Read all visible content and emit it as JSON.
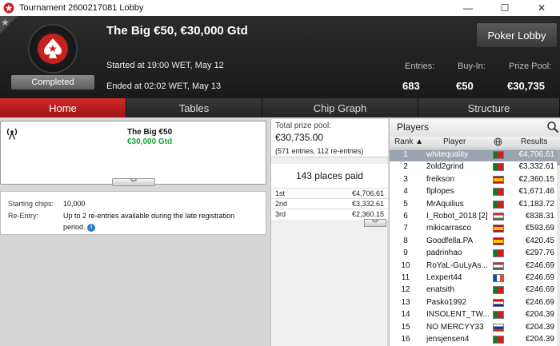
{
  "window": {
    "title": "Tournament 2600217081 Lobby"
  },
  "header": {
    "tournament_name": "The Big €50, €30,000 Gtd",
    "status": "Completed",
    "started": "Started at 19:00 WET, May 12",
    "ended": "Ended at 02:02 WET, May 13",
    "entries_label": "Entries:",
    "entries_value": "683",
    "buyin_label": "Buy-In:",
    "buyin_value": "€50",
    "prizepool_label": "Prize Pool:",
    "prizepool_value": "€30,735",
    "poker_lobby_label": "Poker Lobby"
  },
  "tabs": [
    "Home",
    "Tables",
    "Chip Graph",
    "Structure"
  ],
  "info": {
    "game_name": "The Big €50",
    "game_guarantee": "€30,000 Gtd",
    "starting_chips_label": "Starting chips:",
    "starting_chips_value": "10,000",
    "reentry_label": "Re-Entry:",
    "reentry_value": "Up to 2 re-entries available during the late registration period."
  },
  "prize": {
    "total_label": "Total prize pool:",
    "total_value": "€30,735.00",
    "entries_text": "(571 entries, 112 re-entries)",
    "places_paid": "143 places paid",
    "payouts": [
      {
        "place": "1st",
        "amount": "€4,706.61"
      },
      {
        "place": "2nd",
        "amount": "€3,332.61"
      },
      {
        "place": "3rd",
        "amount": "€2,360.15"
      }
    ]
  },
  "players": {
    "title": "Players",
    "columns": {
      "rank": "Rank",
      "player": "Player",
      "results": "Results"
    },
    "rows": [
      {
        "rank": "1",
        "name": "whitequality",
        "flag": "portugal",
        "result": "€4,706.61"
      },
      {
        "rank": "2",
        "name": "2old2grind",
        "flag": "portugal",
        "result": "€3,332.61"
      },
      {
        "rank": "3",
        "name": "freikson",
        "flag": "spain",
        "result": "€2,360.15"
      },
      {
        "rank": "4",
        "name": "flplopes",
        "flag": "portugal",
        "result": "€1,671.46"
      },
      {
        "rank": "5",
        "name": "MrAquilius",
        "flag": "portugal",
        "result": "€1,183.72"
      },
      {
        "rank": "6",
        "name": "I_Robot_2018 [2]",
        "flag": "hungary",
        "result": "€838.31"
      },
      {
        "rank": "7",
        "name": "mikicarrasco",
        "flag": "spain",
        "result": "€593.69"
      },
      {
        "rank": "8",
        "name": "Goodfella.PA",
        "flag": "spain",
        "result": "€420.45"
      },
      {
        "rank": "9",
        "name": "padrinhao",
        "flag": "portugal",
        "result": "€297.76"
      },
      {
        "rank": "10",
        "name": "RoYaL-GuLyAs...",
        "flag": "hungary",
        "result": "€246.69"
      },
      {
        "rank": "11",
        "name": "Lexpert44",
        "flag": "france",
        "result": "€246.69"
      },
      {
        "rank": "12",
        "name": "enatsith",
        "flag": "portugal",
        "result": "€246.69"
      },
      {
        "rank": "13",
        "name": "Pasko1992",
        "flag": "croatia",
        "result": "€246.69"
      },
      {
        "rank": "14",
        "name": "INSOLENT_TW...",
        "flag": "portugal",
        "result": "€204.39"
      },
      {
        "rank": "15",
        "name": "NO MERCYY33",
        "flag": "russia",
        "result": "€204.39"
      },
      {
        "rank": "16",
        "name": "jensjensen4",
        "flag": "portugal",
        "result": "€204.39"
      }
    ]
  },
  "colors": {
    "accent_red": "#c81f1f",
    "gtd_green": "#1aa33a",
    "selected_row": "#9aa5b1"
  }
}
